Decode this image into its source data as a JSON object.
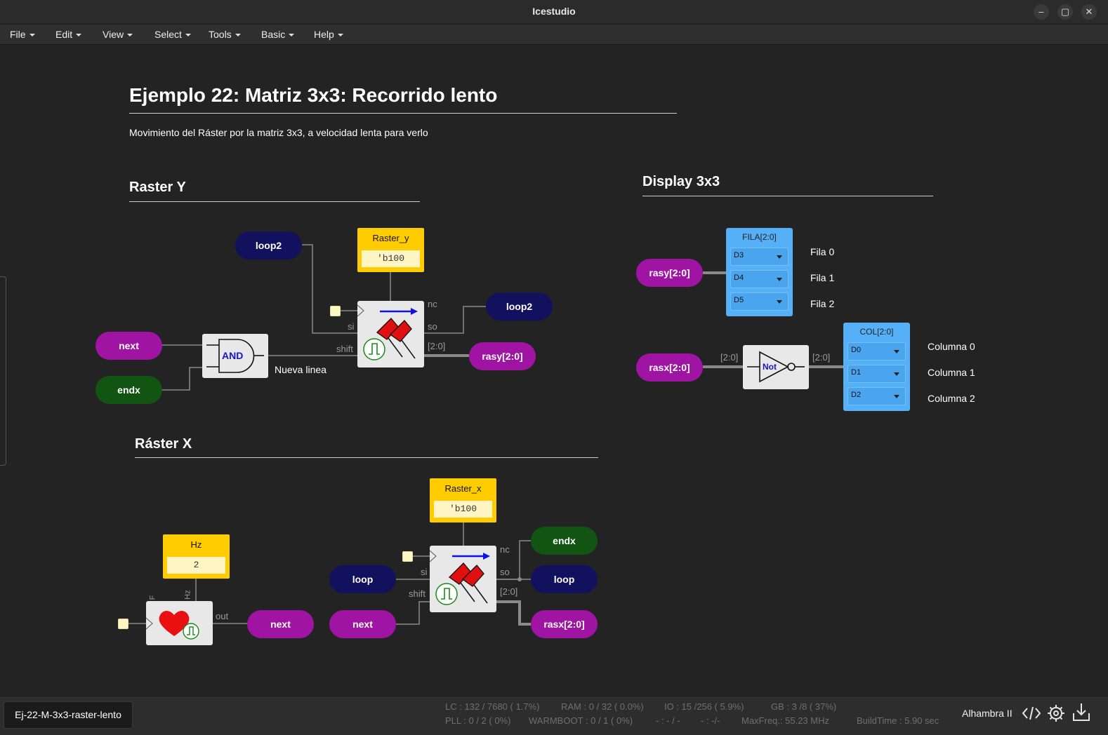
{
  "window": {
    "title": "Icestudio",
    "controls": [
      "–",
      "▢",
      "✕"
    ]
  },
  "menu": [
    {
      "label": "File"
    },
    {
      "label": "Edit"
    },
    {
      "label": "View"
    },
    {
      "label": "Select"
    },
    {
      "label": "Tools"
    },
    {
      "label": "Basic"
    },
    {
      "label": "Help"
    }
  ],
  "canvas": {
    "title": "Ejemplo 22: Matriz 3x3: Recorrido lento",
    "description": "Movimiento del Ráster por la matriz 3x3, a velocidad lenta para verlo",
    "section_raster_y": "Raster Y",
    "section_display": "Display 3x3",
    "section_raster_x": "Ráster X",
    "raster_y": {
      "in_loop2": "loop2",
      "in_next": "next",
      "in_endx": "endx",
      "and_label": "AND",
      "and_out_label": "Nueva linea",
      "const_name": "Raster_y",
      "const_value": "'b100",
      "port_si": "si",
      "port_shift": "shift",
      "port_nc": "nc",
      "port_so": "so",
      "port_bus": "[2:0]",
      "out_loop2": "loop2",
      "out_rasy": "rasy[2:0]"
    },
    "display": {
      "in_rasy": "rasy[2:0]",
      "fila_title": "FILA[2:0]",
      "fila_pins": [
        "D3",
        "D4",
        "D5"
      ],
      "fila_labels": [
        "Fila 0",
        "Fila 1",
        "Fila 2"
      ],
      "in_rasx": "rasx[2:0]",
      "bus_in": "[2:0]",
      "bus_out": "[2:0]",
      "not_label": "Not",
      "col_title": "COL[2:0]",
      "col_pins": [
        "D0",
        "D1",
        "D2"
      ],
      "col_labels": [
        "Columna 0",
        "Columna 1",
        "Columna 2"
      ]
    },
    "raster_x": {
      "hz_name": "Hz",
      "hz_value": "2",
      "port_f": "F",
      "port_hz": "Hz",
      "port_out": "out",
      "out_next": "next",
      "const_name": "Raster_x",
      "const_value": "'b100",
      "in_loop": "loop",
      "in_next": "next",
      "port_si": "si",
      "port_shift": "shift",
      "port_nc": "nc",
      "port_so": "so",
      "port_bus": "[2:0]",
      "out_endx": "endx",
      "out_loop": "loop",
      "out_rasx": "rasx[2:0]"
    }
  },
  "status": {
    "tab": "Ej-22-M-3x3-raster-lento",
    "lc": "LC : 132 / 7680 ( 1.7%)",
    "ram": "RAM : 0 / 32 ( 0.0%)",
    "io": "IO : 15 /256 ( 5.9%)",
    "gb": "GB : 3 /8 ( 37%)",
    "pll": "PLL : 0 / 2 ( 0%)",
    "warmboot": "WARMBOOT : 0 / 1 ( 0%)",
    "misc1": "- : - / -",
    "misc2": "- : -/-",
    "maxfreq": "MaxFreq.: 55.23 MHz",
    "buildtime": "BuildTime : 5.90 sec",
    "board": "Alhambra II"
  },
  "colors": {
    "purple": "#a014a3",
    "navy": "#11115e",
    "green": "#125412",
    "yellow": "#ffcc00",
    "blue": "#55b0f8"
  }
}
